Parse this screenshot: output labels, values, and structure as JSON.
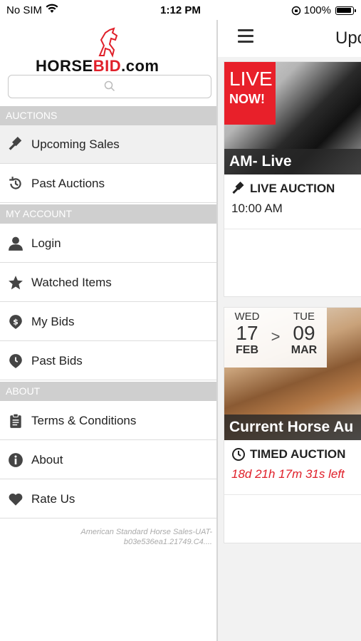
{
  "status_bar": {
    "carrier": "No SIM",
    "time": "1:12 PM",
    "battery": "100%"
  },
  "logo": {
    "brand_part1": "HORSE",
    "brand_part2": "BID",
    "brand_part3": ".com"
  },
  "search": {
    "placeholder": ""
  },
  "drawer": {
    "sections": {
      "auctions": "AUCTIONS",
      "my_account": "MY ACCOUNT",
      "about": "ABOUT"
    },
    "items": {
      "upcoming_sales": "Upcoming Sales",
      "past_auctions": "Past Auctions",
      "login": "Login",
      "watched_items": "Watched Items",
      "my_bids": "My Bids",
      "past_bids": "Past Bids",
      "terms": "Terms & Conditions",
      "about": "About",
      "rate_us": "Rate Us"
    },
    "version_line1": "American Standard Horse Sales-UAT-",
    "version_line2": "b03e536ea1.21749.C4...."
  },
  "main": {
    "title": "Upc",
    "cards": [
      {
        "badge_line1": "LIVE",
        "badge_line2": "NOW!",
        "caption": "AM- Live",
        "type": "LIVE AUCTION",
        "time": "10:00 AM"
      },
      {
        "start_dow": "WED",
        "start_day": "17",
        "start_mon": "FEB",
        "arrow": ">",
        "end_dow": "TUE",
        "end_day": "09",
        "end_mon": "MAR",
        "caption": "Current Horse Au",
        "type": "TIMED AUCTION",
        "time_left": "18d 21h 17m 31s left"
      }
    ]
  },
  "colors": {
    "accent_red": "#e0202a",
    "section_gray": "#cfcfcf"
  }
}
